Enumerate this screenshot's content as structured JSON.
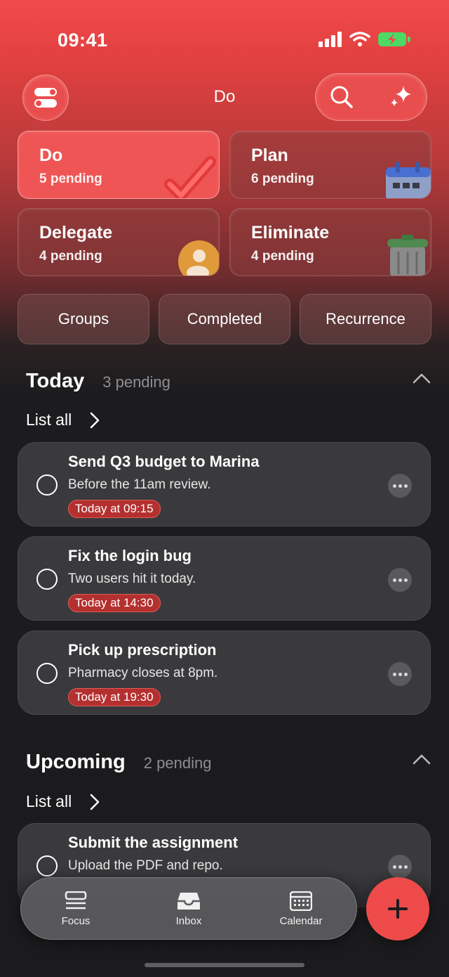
{
  "status_bar": {
    "time": "09:41"
  },
  "header": {
    "title": "Do"
  },
  "quadrants": [
    {
      "title": "Do",
      "subtitle": "5 pending",
      "active": true
    },
    {
      "title": "Plan",
      "subtitle": "6 pending",
      "active": false
    },
    {
      "title": "Delegate",
      "subtitle": "4 pending",
      "active": false
    },
    {
      "title": "Eliminate",
      "subtitle": "4 pending",
      "active": false
    }
  ],
  "filters": [
    "Groups",
    "Completed",
    "Recurrence"
  ],
  "today": {
    "title": "Today",
    "count": "3 pending",
    "list_all": "List all",
    "tasks": [
      {
        "title": "Send Q3 budget to Marina",
        "note": "Before the 11am review.",
        "due": "Today at 09:15"
      },
      {
        "title": "Fix the login bug",
        "note": "Two users hit it today.",
        "due": "Today at 14:30"
      },
      {
        "title": "Pick up prescription",
        "note": "Pharmacy closes at 8pm.",
        "due": "Today at 19:30"
      }
    ]
  },
  "upcoming": {
    "title": "Upcoming",
    "count": "2 pending",
    "list_all": "List all",
    "tasks": [
      {
        "title": "Submit the assignment",
        "note": "Upload the PDF and repo."
      }
    ]
  },
  "tabbar": {
    "tabs": [
      "Focus",
      "Inbox",
      "Calendar"
    ]
  },
  "colors": {
    "accent": "#ee4a4a",
    "due_badge": "#b4302f",
    "card": "#3a3a3d",
    "background": "#1b1b1d"
  }
}
